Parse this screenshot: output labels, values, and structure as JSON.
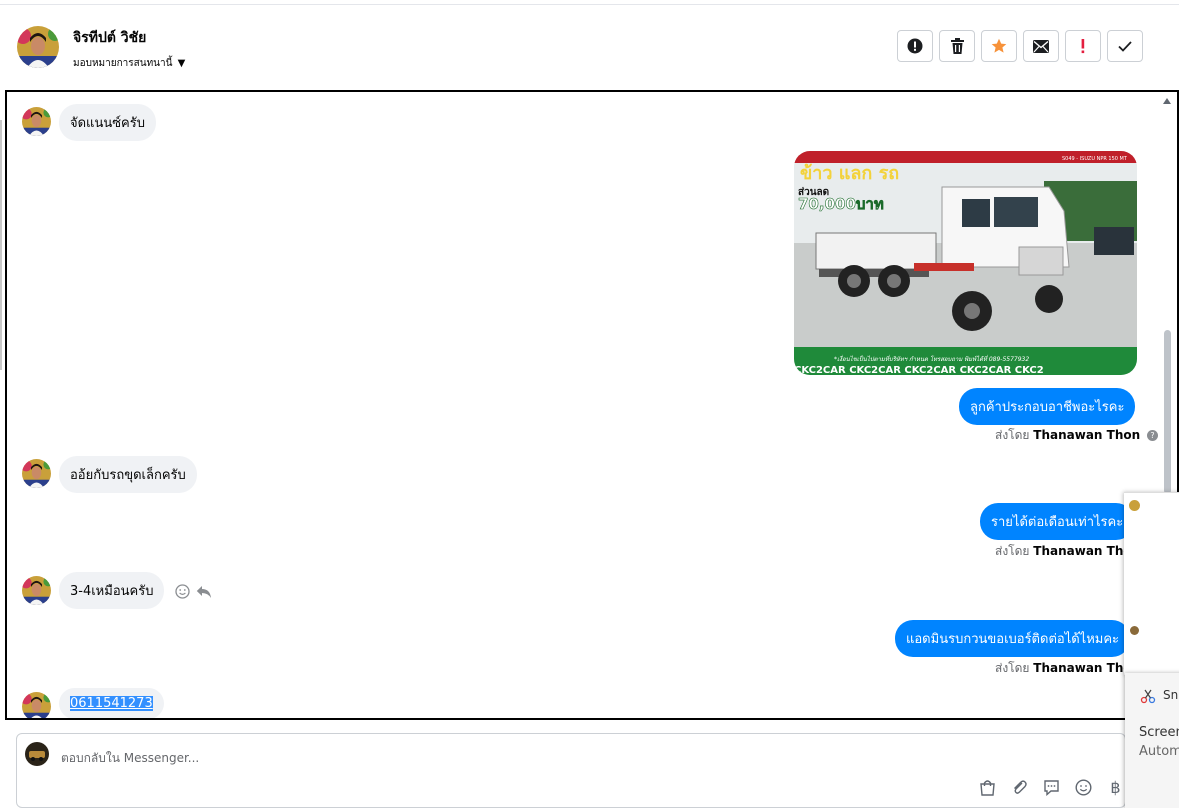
{
  "header": {
    "contact_name": "จิรทีปต์ วิชัย",
    "assign_label": "มอบหมายการสนทนานี้",
    "actions": [
      {
        "name": "report-icon",
        "color": "#050505"
      },
      {
        "name": "trash-icon",
        "color": "#050505"
      },
      {
        "name": "star-icon",
        "color": "#f7923a"
      },
      {
        "name": "envelope-icon",
        "color": "#050505"
      },
      {
        "name": "exclamation-icon",
        "color": "#e41e3f"
      },
      {
        "name": "check-icon",
        "color": "#050505"
      }
    ]
  },
  "messages": {
    "m1": "จัดแนนซ์ครับ",
    "m3": "ลูกค้าประกอบอาชีพอะไรคะ",
    "m4": "ออ้ยกับรถขุดเล็กครับ",
    "m5": "รายได้ต่อเดือนเท่าไรคะ",
    "m6": "3-4เหมือนครับ",
    "m7": "แอดมินรบกวนขอเบอร์ติดต่อได้ไหมคะ",
    "m8": "0611541273"
  },
  "sent_by": {
    "prefix": "ส่งโดย",
    "name": "Thanawan Thon"
  },
  "image_ad": {
    "headline": "ข้าว แลก รถ",
    "discount_label": "ส่วนลด",
    "discount_value": "70,000บาท",
    "model": "S049 - ISUZU NPR 150 MT",
    "footer": "*เงื่อนไขเป็นไปตามที่บริษัทฯ กำหนด โทรสอบถาม พิมพ์ได้ที่ 089-5577932",
    "banner": "CKC2CAR CKC2CAR CKC2CAR CKC2CAR CKC2"
  },
  "composer": {
    "placeholder": "ตอบกลับใน Messenger...",
    "tools": [
      "bag-icon",
      "paperclip-icon",
      "chat-icon",
      "emoji-icon",
      "baht-icon"
    ]
  },
  "overlay": {
    "snip_label": "Sni",
    "line1": "Screen",
    "line2": "Autom"
  },
  "colors": {
    "accent": "#0084ff",
    "incoming_bubble": "#f0f2f5",
    "star": "#f7923a",
    "alert": "#e41e3f"
  }
}
